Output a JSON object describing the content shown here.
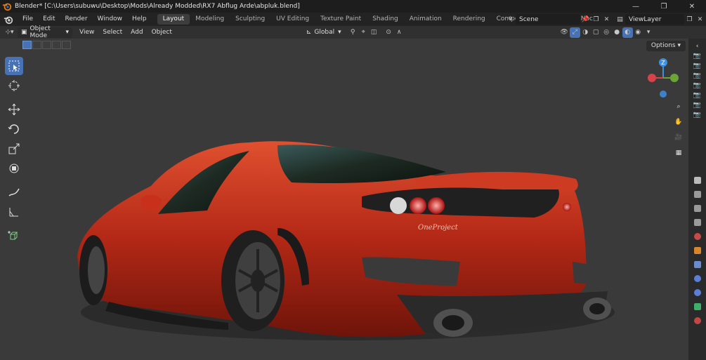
{
  "window": {
    "title": "Blender* [C:\\Users\\subuwu\\Desktop\\Mods\\Already Modded\\RX7 Abflug Arde\\abpluk.blend]",
    "minimize": "—",
    "maximize": "❐",
    "close": "✕"
  },
  "menu": [
    "File",
    "Edit",
    "Render",
    "Window",
    "Help"
  ],
  "workspaces": [
    "Layout",
    "Modeling",
    "Sculpting",
    "UV Editing",
    "Texture Paint",
    "Shading",
    "Animation",
    "Rendering",
    "Compositing",
    "Geometry Noc"
  ],
  "active_workspace": "Layout",
  "scene": {
    "name": "Scene",
    "view_layer": "ViewLayer"
  },
  "header": {
    "mode": "Object Mode",
    "menus": [
      "View",
      "Select",
      "Add",
      "Object"
    ],
    "transform_orientation": "Global"
  },
  "viewport": {
    "options_label": "Options",
    "gizmo_axis_label": "Z"
  },
  "tools": [
    "select-box",
    "cursor",
    "move",
    "rotate",
    "scale",
    "transform",
    "annotate",
    "measure",
    "add-cube"
  ],
  "car_badge": "OneProject",
  "colors": {
    "accent": "#4772b3",
    "car_body": "#c0301c",
    "axis_x": "#d64348",
    "axis_y": "#6aa535",
    "axis_z": "#3d8fe0"
  }
}
